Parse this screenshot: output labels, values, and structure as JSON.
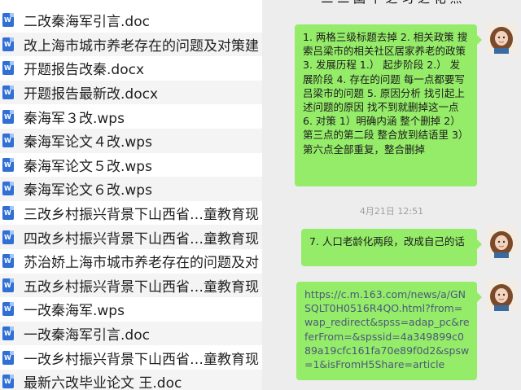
{
  "files": [
    "二改秦海军引言.doc",
    "改上海市城市养老存在的问题及对策建",
    "开题报告改秦.docx",
    "开题报告最新改.docx",
    "秦海军３改.wps",
    "秦海军论文４改.wps",
    "秦海军论文５改.wps",
    "秦海军论文６改.wps",
    "三改乡村振兴背景下山西省…童教育现",
    "四改乡村振兴背景下山西省…童教育现",
    "苏治娇上海市城市养老存在的问题及对",
    "五改乡村振兴背景下山西省…童教育现",
    "一改秦海军.wps",
    "一改秦海军引言.doc",
    "一改乡村振兴背景下山西省…童教育现",
    "最新六改毕业论文 王.doc"
  ],
  "file_icon": "word-document-icon",
  "chat": {
    "title": "二 二 国 十 之 习 之 化 点",
    "messages": {
      "m1": "1. 两格三级标题去掉 2. 相关政策 搜索吕梁市的相关社区居家养老的政策 3. 发展历程 1.） 起步阶段 2.） 发展阶段 4. 存在的问题 每一点都要写吕梁市的问题 5. 原因分析 找引起上述问题的原因 找不到就删掉这一点 6. 对策 1）明确内涵 整个删掉 2） 第三点的第二段 整合放到结语里 3） 第六点全部重复，整合删掉",
      "timestamp": "4月21日 12:51",
      "m2": "7. 人口老龄化两段，改成自己的话",
      "m3": "https://c.m.163.com/news/a/GNSQLT0H0516R4QO.html?from=wap_redirect&spss=adap_pc&referFrom=&spssid=4a349899c089a19cfc161fa70e89f0d2&spsw=1&isFromH5Share=article"
    },
    "bubble_color": "#95ec69",
    "background_color": "#ededed"
  }
}
